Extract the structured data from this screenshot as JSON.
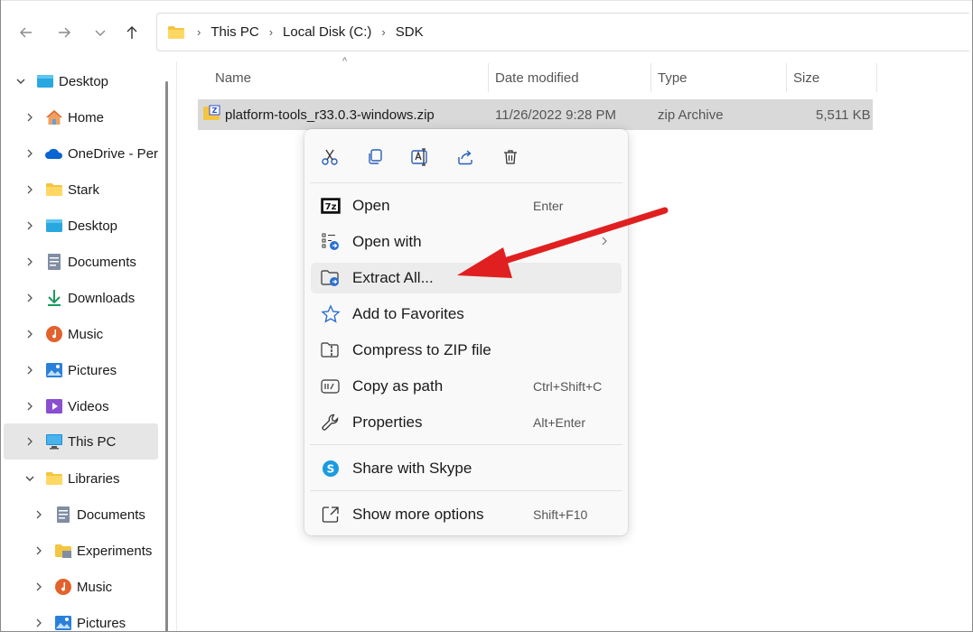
{
  "address": {
    "crumbs": [
      "This PC",
      "Local Disk (C:)",
      "SDK"
    ]
  },
  "sidebar": {
    "items": [
      {
        "label": "Desktop",
        "icon": "desktop-icon",
        "level": 0,
        "expanded": true
      },
      {
        "label": "Home",
        "icon": "home-icon",
        "level": 1
      },
      {
        "label": "OneDrive - Per",
        "icon": "cloud-icon",
        "level": 1
      },
      {
        "label": "Stark",
        "icon": "folder-icon",
        "level": 1
      },
      {
        "label": "Desktop",
        "icon": "desktop-icon",
        "level": 1
      },
      {
        "label": "Documents",
        "icon": "document-icon",
        "level": 1
      },
      {
        "label": "Downloads",
        "icon": "download-icon",
        "level": 1
      },
      {
        "label": "Music",
        "icon": "music-icon",
        "level": 1
      },
      {
        "label": "Pictures",
        "icon": "pictures-icon",
        "level": 1
      },
      {
        "label": "Videos",
        "icon": "videos-icon",
        "level": 1
      },
      {
        "label": "This PC",
        "icon": "computer-icon",
        "level": 1,
        "selected": true
      },
      {
        "label": "Libraries",
        "icon": "folder-icon",
        "level": 1,
        "expanded": true
      },
      {
        "label": "Documents",
        "icon": "document-icon",
        "level": 2
      },
      {
        "label": "Experiments",
        "icon": "folder-icon",
        "level": 2
      },
      {
        "label": "Music",
        "icon": "music-icon",
        "level": 2
      },
      {
        "label": "Pictures",
        "icon": "pictures-icon",
        "level": 2
      }
    ]
  },
  "file_list": {
    "columns": [
      "Name",
      "Date modified",
      "Type",
      "Size"
    ],
    "files": [
      {
        "name": "platform-tools_r33.0.3-windows.zip",
        "date": "11/26/2022 9:28 PM",
        "type": "zip Archive",
        "size": "5,511 KB"
      }
    ]
  },
  "context_menu": {
    "quick_actions": [
      "cut-icon",
      "copy-icon",
      "rename-icon",
      "share-icon",
      "delete-icon"
    ],
    "items": [
      {
        "label": "Open",
        "shortcut": "Enter",
        "icon": "7zip-icon"
      },
      {
        "label": "Open with",
        "shortcut": "",
        "icon": "open-with-icon",
        "submenu": true
      },
      {
        "label": "Extract All...",
        "shortcut": "",
        "icon": "extract-icon",
        "highlighted": true
      },
      {
        "label": "Add to Favorites",
        "shortcut": "",
        "icon": "star-icon"
      },
      {
        "label": "Compress to ZIP file",
        "shortcut": "",
        "icon": "zip-folder-icon"
      },
      {
        "label": "Copy as path",
        "shortcut": "Ctrl+Shift+C",
        "icon": "copy-path-icon"
      },
      {
        "label": "Properties",
        "shortcut": "Alt+Enter",
        "icon": "wrench-icon"
      },
      {
        "label": "Share with Skype",
        "shortcut": "",
        "icon": "skype-icon"
      },
      {
        "label": "Show more options",
        "shortcut": "Shift+F10",
        "icon": "more-options-icon"
      }
    ]
  },
  "colors": {
    "accent": "#0067c0",
    "annotation_arrow": "#e02020",
    "folder": "#f4c542"
  }
}
